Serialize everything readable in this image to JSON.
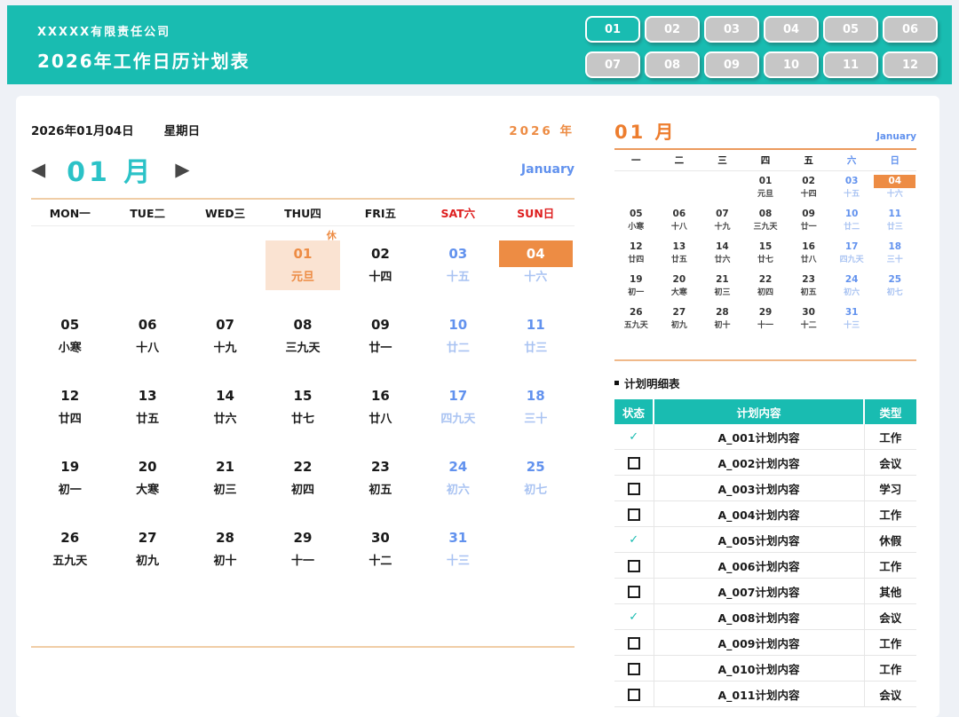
{
  "theme": {
    "teal": "#19bcb1",
    "cyan": "#2bc2c7",
    "orange": "#ed8c44",
    "light_orange": "#fae3d2",
    "blue": "#6292ee",
    "light_blue": "#a9c3f2",
    "red": "#de1f1f",
    "tan_line": "#f0cda6",
    "button_gray": "#c6c6c6",
    "background": "#eef1f6"
  },
  "icons": {
    "prev_arrow": "◀",
    "next_arrow": "▶",
    "check": "✓"
  },
  "header": {
    "company": "XXXXX有限责任公司",
    "title": "2026年工作日历计划表",
    "months": [
      "01",
      "02",
      "03",
      "04",
      "05",
      "06",
      "07",
      "08",
      "09",
      "10",
      "11",
      "12"
    ],
    "selected_month": "01"
  },
  "main": {
    "date_text": "2026年01月04日",
    "weekday_text": "星期日",
    "year_label": "2026 年",
    "month_num": "01",
    "month_unit": "月",
    "month_en": "January",
    "weekdays": [
      {
        "label": "MON一",
        "weekend": false
      },
      {
        "label": "TUE二",
        "weekend": false
      },
      {
        "label": "WED三",
        "weekend": false
      },
      {
        "label": "THU四",
        "weekend": false
      },
      {
        "label": "FRI五",
        "weekend": false
      },
      {
        "label": "SAT六",
        "weekend": true
      },
      {
        "label": "SUN日",
        "weekend": true
      }
    ]
  },
  "mini": {
    "month_num": "01",
    "month_unit": "月",
    "month_en": "January",
    "weekdays": [
      {
        "label": "一",
        "weekend": false
      },
      {
        "label": "二",
        "weekend": false
      },
      {
        "label": "三",
        "weekend": false
      },
      {
        "label": "四",
        "weekend": false
      },
      {
        "label": "五",
        "weekend": false
      },
      {
        "label": "六",
        "weekend": true
      },
      {
        "label": "日",
        "weekend": true
      }
    ]
  },
  "calendar": {
    "weeks": [
      [
        null,
        null,
        null,
        {
          "day": "01",
          "lunar": "元旦",
          "kind": "holiday",
          "badge": "休"
        },
        {
          "day": "02",
          "lunar": "十四",
          "kind": "work"
        },
        {
          "day": "03",
          "lunar": "十五",
          "kind": "weekend"
        },
        {
          "day": "04",
          "lunar": "十六",
          "kind": "today"
        }
      ],
      [
        {
          "day": "05",
          "lunar": "小寒",
          "kind": "work"
        },
        {
          "day": "06",
          "lunar": "十八",
          "kind": "work"
        },
        {
          "day": "07",
          "lunar": "十九",
          "kind": "work"
        },
        {
          "day": "08",
          "lunar": "三九天",
          "kind": "work"
        },
        {
          "day": "09",
          "lunar": "廿一",
          "kind": "work"
        },
        {
          "day": "10",
          "lunar": "廿二",
          "kind": "weekend"
        },
        {
          "day": "11",
          "lunar": "廿三",
          "kind": "weekend"
        }
      ],
      [
        {
          "day": "12",
          "lunar": "廿四",
          "kind": "work"
        },
        {
          "day": "13",
          "lunar": "廿五",
          "kind": "work"
        },
        {
          "day": "14",
          "lunar": "廿六",
          "kind": "work"
        },
        {
          "day": "15",
          "lunar": "廿七",
          "kind": "work"
        },
        {
          "day": "16",
          "lunar": "廿八",
          "kind": "work"
        },
        {
          "day": "17",
          "lunar": "四九天",
          "kind": "weekend"
        },
        {
          "day": "18",
          "lunar": "三十",
          "kind": "weekend"
        }
      ],
      [
        {
          "day": "19",
          "lunar": "初一",
          "kind": "work"
        },
        {
          "day": "20",
          "lunar": "大寒",
          "kind": "work"
        },
        {
          "day": "21",
          "lunar": "初三",
          "kind": "work"
        },
        {
          "day": "22",
          "lunar": "初四",
          "kind": "work"
        },
        {
          "day": "23",
          "lunar": "初五",
          "kind": "work"
        },
        {
          "day": "24",
          "lunar": "初六",
          "kind": "weekend"
        },
        {
          "day": "25",
          "lunar": "初七",
          "kind": "weekend"
        }
      ],
      [
        {
          "day": "26",
          "lunar": "五九天",
          "kind": "work"
        },
        {
          "day": "27",
          "lunar": "初九",
          "kind": "work"
        },
        {
          "day": "28",
          "lunar": "初十",
          "kind": "work"
        },
        {
          "day": "29",
          "lunar": "十一",
          "kind": "work"
        },
        {
          "day": "30",
          "lunar": "十二",
          "kind": "work"
        },
        {
          "day": "31",
          "lunar": "十三",
          "kind": "weekend"
        },
        null
      ]
    ]
  },
  "plan": {
    "section_title": "计划明细表",
    "columns": [
      "状态",
      "计划内容",
      "类型"
    ],
    "rows": [
      {
        "done": true,
        "content": "A_001计划内容",
        "type": "工作"
      },
      {
        "done": false,
        "content": "A_002计划内容",
        "type": "会议"
      },
      {
        "done": false,
        "content": "A_003计划内容",
        "type": "学习"
      },
      {
        "done": false,
        "content": "A_004计划内容",
        "type": "工作"
      },
      {
        "done": true,
        "content": "A_005计划内容",
        "type": "休假"
      },
      {
        "done": false,
        "content": "A_006计划内容",
        "type": "工作"
      },
      {
        "done": false,
        "content": "A_007计划内容",
        "type": "其他"
      },
      {
        "done": true,
        "content": "A_008计划内容",
        "type": "会议"
      },
      {
        "done": false,
        "content": "A_009计划内容",
        "type": "工作"
      },
      {
        "done": false,
        "content": "A_010计划内容",
        "type": "工作"
      },
      {
        "done": false,
        "content": "A_011计划内容",
        "type": "会议"
      }
    ]
  }
}
